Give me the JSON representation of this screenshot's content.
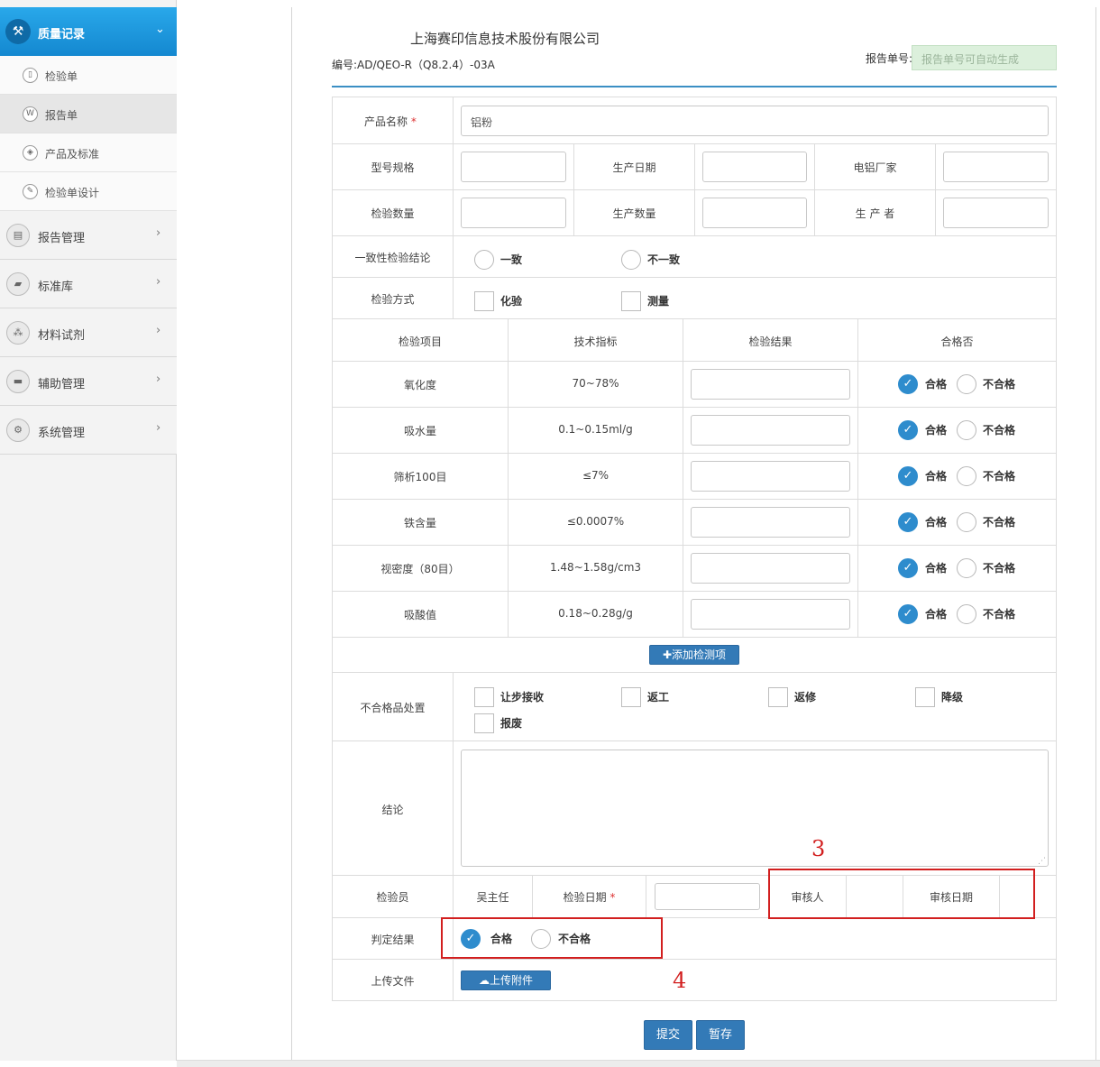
{
  "sidebar": {
    "header": {
      "label": "质量记录",
      "icon": "hammer-icon"
    },
    "sub_items": [
      {
        "label": "检验单",
        "icon": "doc-icon"
      },
      {
        "label": "报告单",
        "icon": "word-doc-icon"
      },
      {
        "label": "产品及标准",
        "icon": "box-icon"
      },
      {
        "label": "检验单设计",
        "icon": "wrench-icon"
      }
    ],
    "main_items": [
      {
        "label": "报告管理",
        "icon": "report-icon"
      },
      {
        "label": "标准库",
        "icon": "book-icon"
      },
      {
        "label": "材料试剂",
        "icon": "cubes-icon"
      },
      {
        "label": "辅助管理",
        "icon": "briefcase-icon"
      },
      {
        "label": "系统管理",
        "icon": "cogs-icon"
      }
    ]
  },
  "form": {
    "company": "上海赛印信息技术股份有限公司",
    "doc_no": "编号:AD/QEO-R（Q8.2.4）-03A",
    "report_no_label": "报告单号:",
    "report_no_placeholder": "报告单号可自动生成",
    "product_name_label": "产品名称",
    "product_name_value": "铝粉",
    "required_mark": "*",
    "model_label": "型号规格",
    "prod_date_label": "生产日期",
    "supplier_label": "电铝厂家",
    "insp_qty_label": "检验数量",
    "prod_qty_label": "生产数量",
    "producer_label": "生 产 者",
    "consistency_label": "一致性检验结论",
    "consistent": "一致",
    "inconsistent": "不一致",
    "method_label": "检验方式",
    "method_chem": "化验",
    "method_measure": "测量",
    "col_item": "检验项目",
    "col_spec": "技术指标",
    "col_result": "检验结果",
    "col_pass": "合格否",
    "pass": "合格",
    "fail": "不合格",
    "items": [
      {
        "name": "氧化度",
        "spec": "70~78%"
      },
      {
        "name": "吸水量",
        "spec": "0.1~0.15ml/g"
      },
      {
        "name": "筛析100目",
        "spec": "≤7%"
      },
      {
        "name": "铁含量",
        "spec": "≤0.0007%"
      },
      {
        "name": "视密度（80目）",
        "spec": "1.48~1.58g/cm3"
      },
      {
        "name": "吸酸值",
        "spec": "0.18~0.28g/g"
      }
    ],
    "add_item_button": "✚添加检测项",
    "nonconform_label": "不合格品处置",
    "dispositions": [
      "让步接收",
      "返工",
      "返修",
      "降级",
      "报废"
    ],
    "conclusion_label": "结论",
    "inspector_label": "检验员",
    "inspector_value": "吴主任",
    "insp_date_label": "检验日期",
    "reviewer_label": "审核人",
    "review_date_label": "审核日期",
    "judgment_label": "判定结果",
    "upload_label": "上传文件",
    "upload_button": "上传附件",
    "submit_button": "提交",
    "save_button": "暂存"
  },
  "annotations": {
    "box3_number": "3",
    "box4_number": "4"
  },
  "colors": {
    "accent": "#337ab7",
    "annotation": "#d21f1f"
  }
}
